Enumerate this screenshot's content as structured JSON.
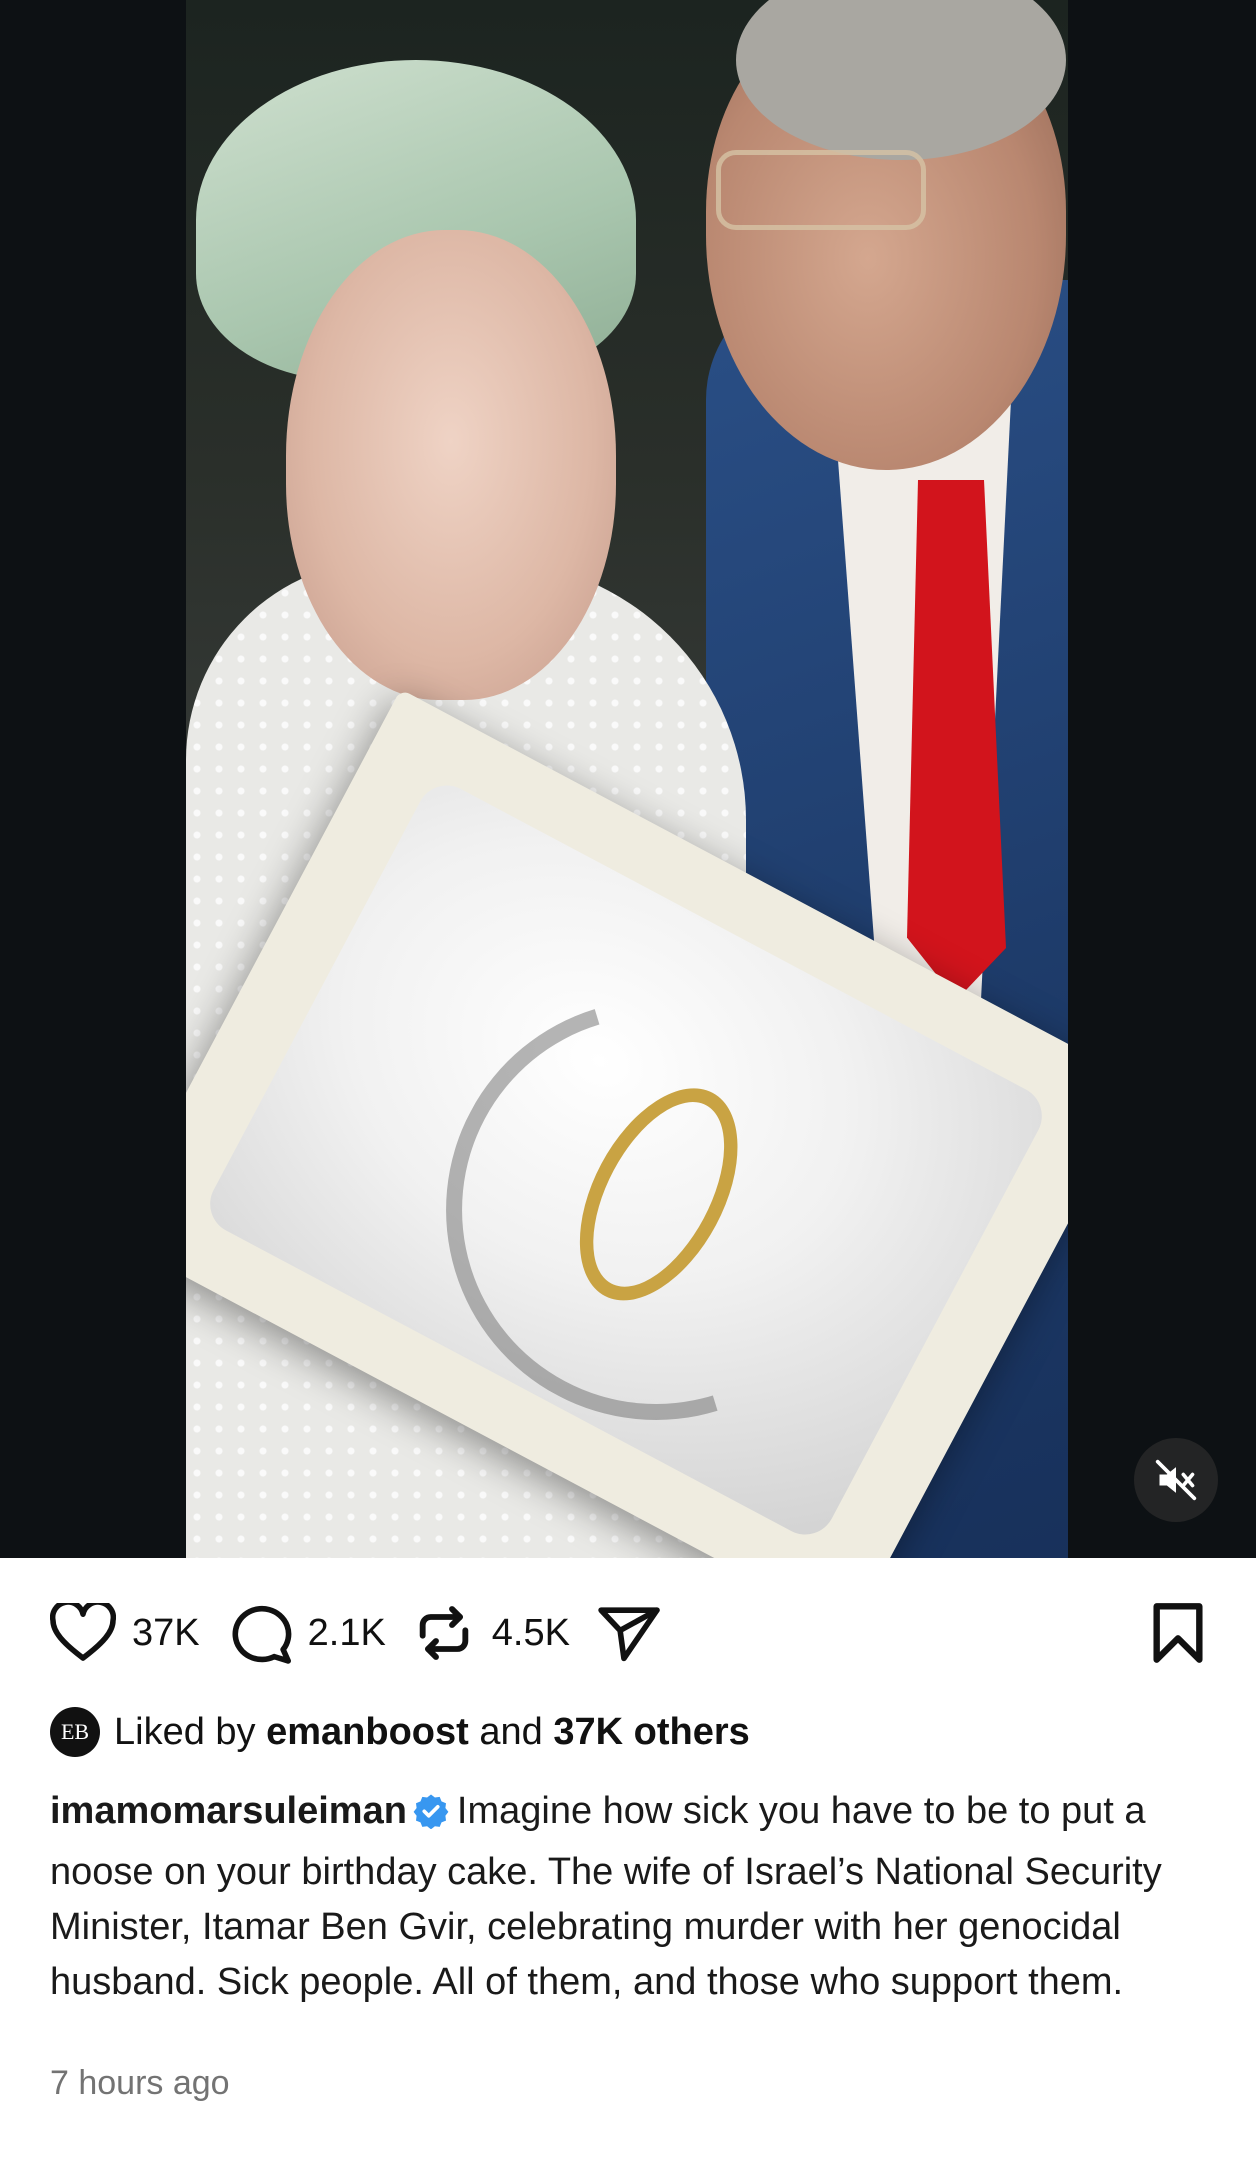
{
  "video": {
    "muted": true,
    "mute_icon": "speaker-muted-icon"
  },
  "actions": {
    "likes": "37K",
    "comments": "2.1K",
    "reposts": "4.5K",
    "like_icon": "heart-icon",
    "comment_icon": "comment-bubble-icon",
    "repost_icon": "repost-icon",
    "share_icon": "send-icon",
    "save_icon": "bookmark-icon"
  },
  "liked_by": {
    "avatar_text": "EB",
    "prefix": "Liked by",
    "user": "emanboost",
    "and": "and",
    "others": "37K others"
  },
  "post": {
    "username": "imamomarsuleiman",
    "verified": true,
    "caption": "Imagine how sick you have to be to put a noose on your birthday cake. The wife of Israel’s National Security Minister, Itamar Ben Gvir, celebrating murder with her genocidal husband. Sick people. All of them, and those who support them.",
    "timestamp": "7 hours ago"
  },
  "colors": {
    "verified_badge": "#3897f0",
    "text_primary": "#111111",
    "text_secondary": "#737373"
  }
}
